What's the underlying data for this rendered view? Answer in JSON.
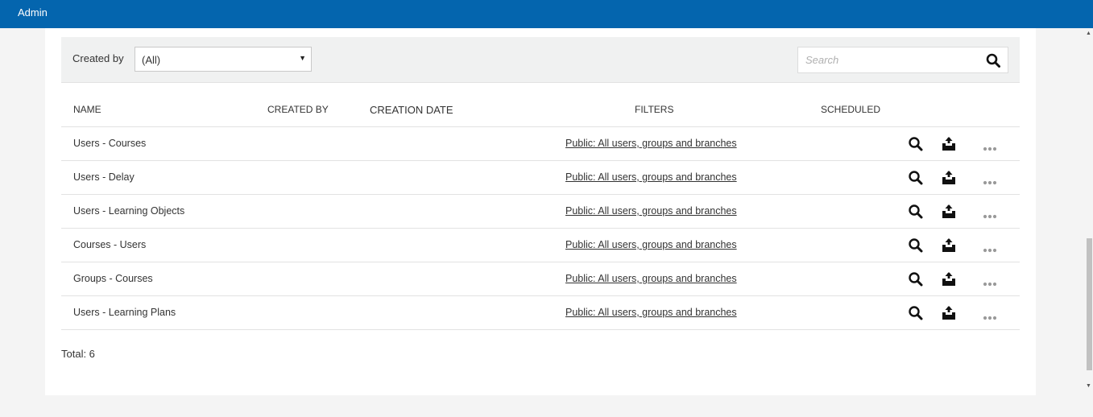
{
  "header": {
    "title": "Admin"
  },
  "filters": {
    "created_by_label": "Created by",
    "created_by_value": "(All)",
    "search_placeholder": "Search"
  },
  "table": {
    "columns": [
      "NAME",
      "CREATED BY",
      "CREATION DATE",
      "FILTERS",
      "SCHEDULED"
    ],
    "rows": [
      {
        "name": "Users - Courses",
        "created_by": "",
        "creation_date": "",
        "filters": "Public: All users, groups and branches",
        "scheduled": ""
      },
      {
        "name": "Users - Delay",
        "created_by": "",
        "creation_date": "",
        "filters": "Public: All users, groups and branches",
        "scheduled": ""
      },
      {
        "name": "Users - Learning Objects",
        "created_by": "",
        "creation_date": "",
        "filters": "Public: All users, groups and branches",
        "scheduled": ""
      },
      {
        "name": "Courses - Users",
        "created_by": "",
        "creation_date": "",
        "filters": "Public: All users, groups and branches",
        "scheduled": ""
      },
      {
        "name": "Groups - Courses",
        "created_by": "",
        "creation_date": "",
        "filters": "Public: All users, groups and branches",
        "scheduled": ""
      },
      {
        "name": "Users - Learning Plans",
        "created_by": "",
        "creation_date": "",
        "filters": "Public: All users, groups and branches",
        "scheduled": ""
      }
    ],
    "row_icons": [
      "magnifier-icon",
      "download-icon",
      "more-options-icon"
    ]
  },
  "footer": {
    "total": "Total: 6"
  },
  "colors": {
    "header_bg": "#0465ae",
    "filterbar_bg": "#f0f1f1",
    "page_bg": "#f4f4f4"
  }
}
